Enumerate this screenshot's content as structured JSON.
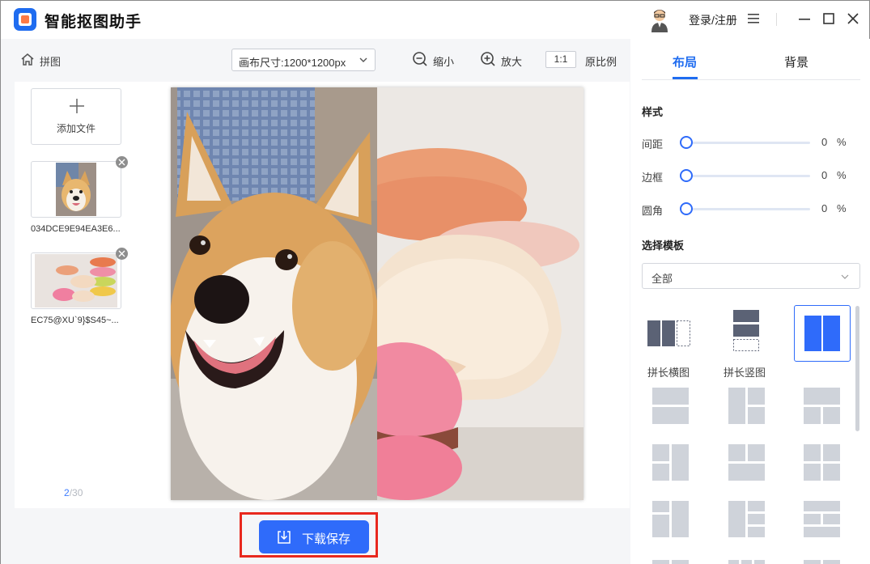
{
  "app": {
    "title": "智能抠图助手",
    "login": "登录/注册"
  },
  "toolbar": {
    "crumb": "拼图",
    "canvas_size": "画布尺寸:1200*1200px",
    "zoom_out": "缩小",
    "zoom_in": "放大",
    "ratio_badge": "1:1",
    "ratio_label": "原比例"
  },
  "files": {
    "add_label": "添加文件",
    "items": [
      {
        "name": "034DCE9E94EA3E6..."
      },
      {
        "name": "EC75@XU`9}$S45~..."
      }
    ],
    "count_current": "2",
    "count_total": "/30"
  },
  "download": {
    "label": "下载保存"
  },
  "right": {
    "tabs": [
      "布局",
      "背景"
    ],
    "style_title": "样式",
    "sliders": [
      {
        "label": "间距",
        "value": "0",
        "unit": "%",
        "level": 0
      },
      {
        "label": "边框",
        "value": "0",
        "unit": "%",
        "level": 0
      },
      {
        "label": "圆角",
        "value": "0",
        "unit": "%",
        "level": 0
      }
    ],
    "template_title": "选择模板",
    "template_filter": "全部",
    "templates": [
      {
        "label": "拼长横图"
      },
      {
        "label": "拼长竖图"
      }
    ]
  },
  "colors": {
    "accent": "#2f6bfa",
    "highlight": "#e8281e",
    "template_gray": "#cfd3da",
    "template_dark": "#5b6275"
  }
}
